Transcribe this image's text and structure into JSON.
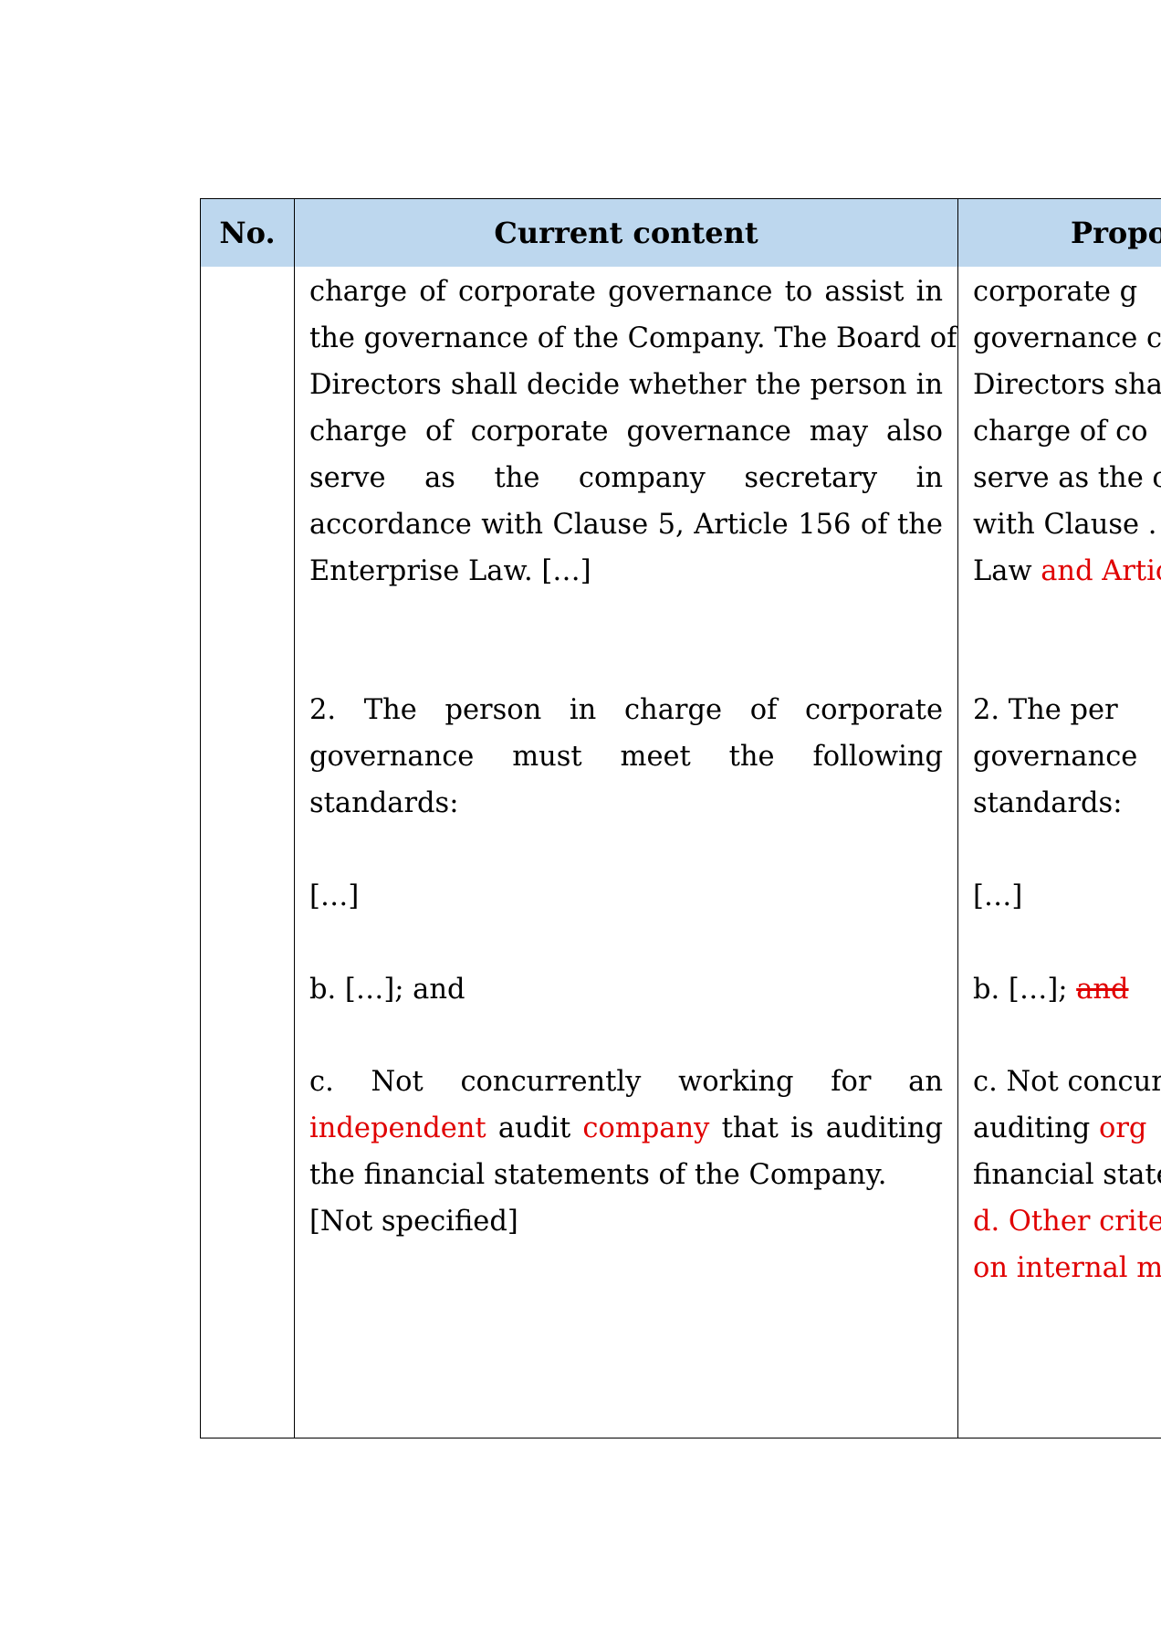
{
  "table": {
    "headers": {
      "no": "No.",
      "current": "Current content",
      "proposed": "Propo"
    },
    "current": {
      "para1": [
        "charge of corporate governance to assist in",
        "the governance of the Company. The Board of",
        "Directors shall decide whether the person in",
        "charge of corporate governance may also",
        "serve as the company secretary in",
        "accordance with Clause 5, Article 156 of the",
        "Enterprise Law. […]"
      ],
      "para2": [
        "2. The person in charge of corporate",
        "governance must meet the following",
        "standards:"
      ],
      "ellipsis": "[…]",
      "item_b": "b. […]; and",
      "item_c": {
        "line1": "c. Not concurrently working for an",
        "line2_red1": "independent",
        "line2_mid": " audit ",
        "line2_red2": "company",
        "line2_end": " that is auditing",
        "line3": "the financial statements of the Company."
      },
      "not_specified": "[Not specified]"
    },
    "proposed": {
      "para1": [
        "corporate g",
        "governance c",
        "Directors sha",
        "charge of co",
        "serve as the c",
        "with Clause ."
      ],
      "para1_last_black": "Law ",
      "para1_last_red": "and Artic",
      "para2": [
        "2. The per",
        "governance",
        "standards:"
      ],
      "ellipsis": "[…]",
      "item_b_black": "b. […]; ",
      "item_b_struck": "and",
      "item_c_line1": "c. Not concur",
      "item_c_line2_black": "auditing ",
      "item_c_line2_red": "org",
      "item_c_line3": "financial state",
      "item_d_line1": "d. Other crite",
      "item_d_line2": "on internal m"
    }
  }
}
